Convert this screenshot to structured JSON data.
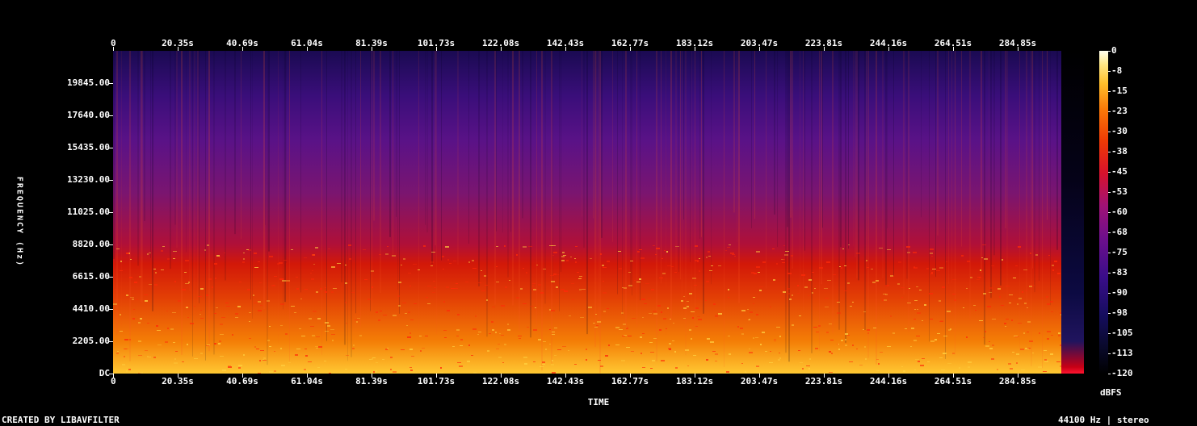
{
  "chart_data": {
    "type": "heatmap",
    "title": "",
    "xlabel": "TIME",
    "ylabel": "FREQUENCY (Hz)",
    "x_ticks": [
      "0",
      "20.35s",
      "40.69s",
      "61.04s",
      "81.39s",
      "101.73s",
      "122.08s",
      "142.43s",
      "162.77s",
      "183.12s",
      "203.47s",
      "223.81s",
      "244.16s",
      "264.51s",
      "284.85s"
    ],
    "y_ticks": [
      "DC",
      "2205.00",
      "4410.00",
      "6615.00",
      "8820.00",
      "11025.00",
      "13230.00",
      "15435.00",
      "17640.00",
      "19845.00"
    ],
    "y_range_hz": [
      0,
      22050
    ],
    "colorbar": {
      "label": "dBFS",
      "ticks": [
        "0",
        "-8",
        "-15",
        "-23",
        "-30",
        "-38",
        "-45",
        "-53",
        "-60",
        "-68",
        "-75",
        "-83",
        "-90",
        "-98",
        "-105",
        "-113",
        "-120"
      ],
      "range": [
        -120,
        0
      ]
    },
    "colormap": [
      "#000000",
      "#150d5e",
      "#3a0d8a",
      "#6e0f8c",
      "#a01276",
      "#d7122c",
      "#ee3a05",
      "#fa7a08",
      "#ffc02c",
      "#ffe98a",
      "#fffff0"
    ]
  },
  "footer": {
    "left": "CREATED BY LIBAVFILTER",
    "right": "44100 Hz | stereo"
  }
}
